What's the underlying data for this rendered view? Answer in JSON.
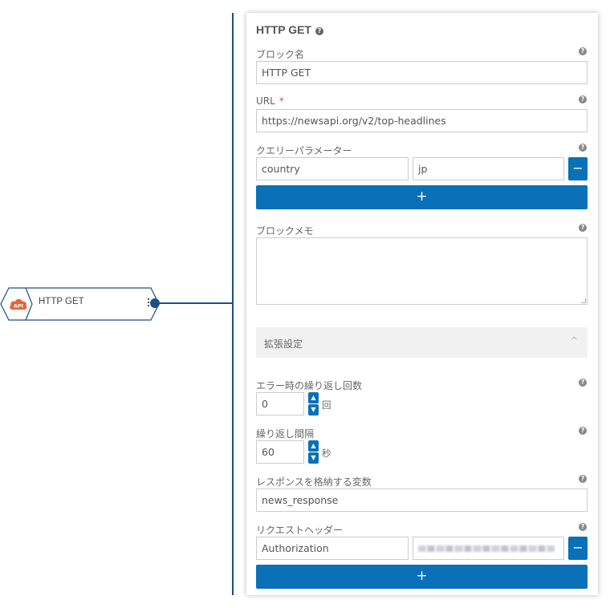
{
  "node": {
    "label": "HTTP GET",
    "icon_text": "API",
    "icon_color": "#e8643a"
  },
  "panel": {
    "title": "HTTP GET",
    "block_name": {
      "label": "ブロック名",
      "value": "HTTP GET"
    },
    "url": {
      "label": "URL",
      "required_mark": "*",
      "value": "https://newsapi.org/v2/top-headlines"
    },
    "query_params": {
      "label": "クエリーパラメーター",
      "rows": [
        {
          "key": "country",
          "value": "jp"
        }
      ],
      "remove_label": "−",
      "add_label": "+"
    },
    "memo": {
      "label": "ブロックメモ",
      "value": ""
    },
    "advanced": {
      "label": "拡張設定",
      "chevron": "^"
    },
    "retry_count": {
      "label": "エラー時の繰り返し回数",
      "value": "0",
      "unit": "回"
    },
    "retry_interval": {
      "label": "繰り返し間隔",
      "value": "60",
      "unit": "秒"
    },
    "response_var": {
      "label": "レスポンスを格納する変数",
      "value": "news_response"
    },
    "request_headers": {
      "label": "リクエストヘッダー",
      "rows": [
        {
          "key": "Authorization",
          "value": ""
        }
      ],
      "remove_label": "−",
      "add_label": "+"
    },
    "help_glyph": "?"
  },
  "colors": {
    "accent": "#0a70b8",
    "connector": "#1c4f86",
    "required": "#d9534f"
  }
}
